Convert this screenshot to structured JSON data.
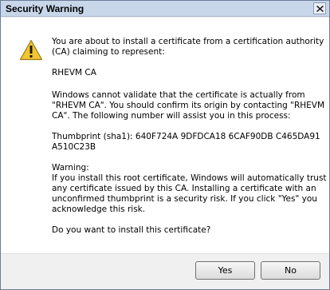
{
  "dialog": {
    "title": "Security Warning",
    "icons": {
      "warning": "warning-icon",
      "close": "close-icon"
    },
    "paragraphs": [
      [
        "You are about to install a certificate from a certification authority",
        "(CA) claiming to represent:"
      ],
      [
        "RHEVM CA"
      ],
      [
        "Windows cannot validate that the certificate is actually from",
        "\"RHEVM CA\". You should confirm its origin by contacting \"RHEVM",
        "CA\". The following number will assist you in this process:"
      ],
      [
        "Thumbprint (sha1): 640F724A 9DFDCA18 6CAF90DB C465DA91",
        "A510C23B"
      ],
      [
        "Warning:",
        "If you install this root certificate, Windows will automatically trust",
        "any certificate issued by this CA. Installing a certificate with an",
        "unconfirmed thumbprint is a security risk. If you click \"Yes\" you",
        "acknowledge this risk."
      ],
      [
        "Do you want to install this certificate?"
      ]
    ],
    "buttons": {
      "yes": "Yes",
      "no": "No"
    }
  }
}
